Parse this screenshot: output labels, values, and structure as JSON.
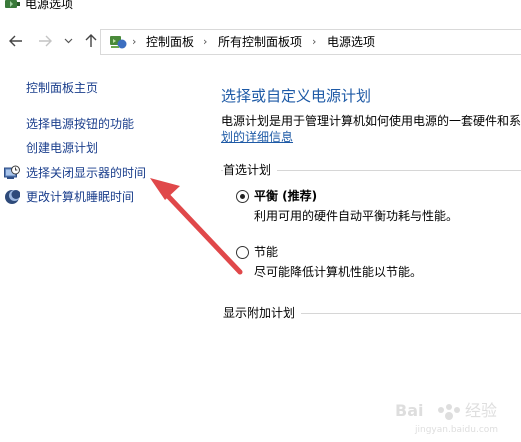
{
  "window": {
    "title": "电源选项",
    "icon": "power-options-icon"
  },
  "nav": {
    "back_icon": "arrow-left-icon",
    "forward_icon": "arrow-right-icon",
    "recent_icon": "chevron-down-icon",
    "up_icon": "arrow-up-icon"
  },
  "breadcrumb": {
    "icon": "control-panel-icon",
    "items": [
      "控制面板",
      "所有控制面板项",
      "电源选项"
    ],
    "separator": "›"
  },
  "sidebar": {
    "items": [
      {
        "label": "控制面板主页",
        "icon": null
      },
      {
        "label": "选择电源按钮的功能",
        "icon": null
      },
      {
        "label": "创建电源计划",
        "icon": null
      },
      {
        "label": "选择关闭显示器的时间",
        "icon": "monitor-clock-icon"
      },
      {
        "label": "更改计算机睡眠时间",
        "icon": "moon-icon"
      }
    ]
  },
  "main": {
    "title": "选择或自定义电源计划",
    "description": "电源计划是用于管理计算机如何使用电源的一套硬件和系",
    "link": "划的详细信息",
    "preferred_section": "首选计划",
    "plans": [
      {
        "name": "平衡 (推荐)",
        "description": "利用可用的硬件自动平衡功耗与性能。",
        "selected": true
      },
      {
        "name": "节能",
        "description": "尽可能降低计算机性能以节能。",
        "selected": false
      }
    ],
    "additional_section": "显示附加计划"
  },
  "annotation": {
    "arrow_color": "#e0484a"
  }
}
